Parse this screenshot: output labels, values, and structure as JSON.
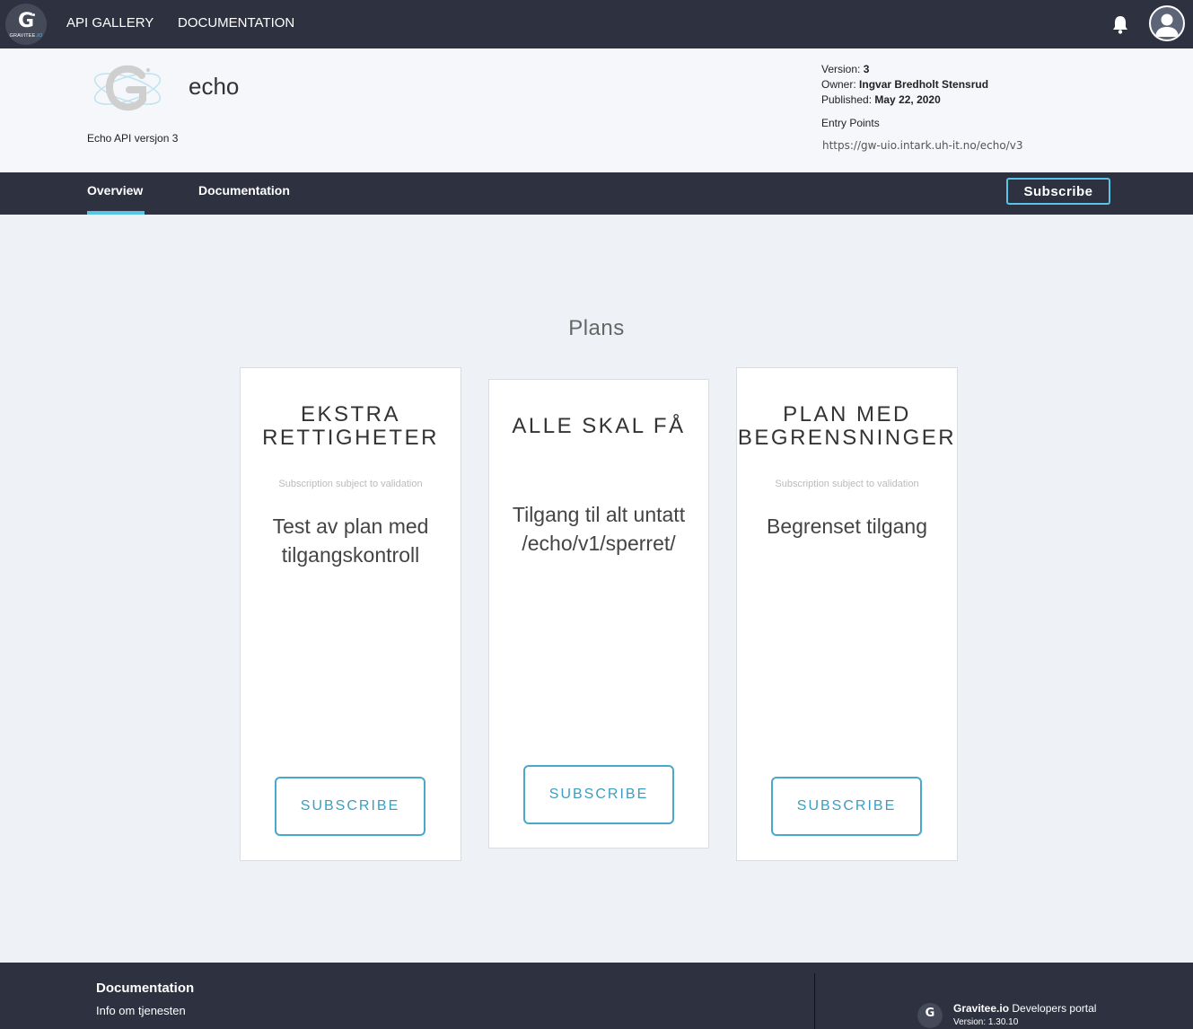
{
  "topbar": {
    "logo_text": "GRAVITEE",
    "logo_io": ".IO",
    "logo_letter": "G",
    "nav": [
      "API GALLERY",
      "DOCUMENTATION"
    ],
    "icons": [
      "bell-icon",
      "user-avatar-icon"
    ]
  },
  "api": {
    "name": "echo",
    "description": "Echo API versjon 3",
    "version_label": "Version:",
    "version": "3",
    "owner_label": "Owner:",
    "owner": "Ingvar Bredholt Stensrud",
    "published_label": "Published:",
    "published": "May 22, 2020",
    "entry_points_label": "Entry Points",
    "entry_point": "https://gw-uio.intark.uh-it.no/echo/v3"
  },
  "subnav": {
    "tabs": [
      "Overview",
      "Documentation"
    ],
    "active_tab": "Overview",
    "subscribe_label": "Subscribe"
  },
  "plans": {
    "title": "Plans",
    "cards": [
      {
        "name_line1": "EKSTRA",
        "name_line2": "RETTIGHETER",
        "validation": "Subscription subject to validation",
        "desc_line1": "Test av plan med",
        "desc_line2": "tilgangskontroll",
        "button": "SUBSCRIBE"
      },
      {
        "name_line1": "ALLE SKAL FÅ",
        "validation": "",
        "desc_line1": "Tilgang til alt untatt",
        "desc_line2": "/echo/v1/sperret/",
        "button": "SUBSCRIBE"
      },
      {
        "name_line1": "PLAN MED",
        "name_line2": "BEGRENSNINGER",
        "validation": "Subscription subject to validation",
        "desc_line1": "Begrenset tilgang",
        "button": "SUBSCRIBE"
      }
    ]
  },
  "footer": {
    "title": "Documentation",
    "link": "Info om tjenesten",
    "portal_brand": "Gravitee.io",
    "portal_text": "Developers portal",
    "version": "Version: 1.30.10",
    "logo_letter": "G"
  }
}
